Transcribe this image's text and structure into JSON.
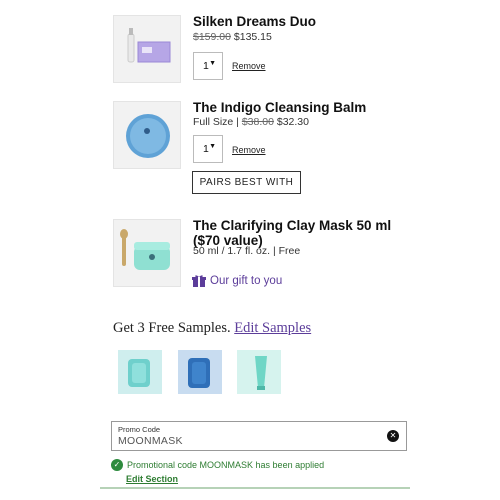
{
  "cart": {
    "items": [
      {
        "name": "Silken Dreams Duo",
        "original_price": "$159.00",
        "price": "$135.15",
        "qty": "1",
        "remove_label": "Remove",
        "thumb_icon": "silken-dreams-duo-product"
      },
      {
        "name": "The Indigo Cleansing Balm",
        "size_prefix": "Full Size | ",
        "original_price": "$38.00",
        "price": "$32.30",
        "qty": "1",
        "remove_label": "Remove",
        "pairs_label": "PAIRS BEST WITH",
        "thumb_icon": "indigo-balm-jar"
      },
      {
        "name_line1": "The Clarifying Clay Mask 50 ml",
        "name_line2": "($70 value)",
        "detail": "50 ml / 1.7 fl. oz. | Free",
        "gift_label": "Our gift to you",
        "thumb_icon": "clay-mask-jar"
      }
    ]
  },
  "samples": {
    "title": "Get 3 Free Samples. ",
    "edit_label": "Edit Samples",
    "items": [
      "aqua-sample",
      "blue-sample",
      "teal-tube-sample"
    ]
  },
  "promo": {
    "label": "Promo Code",
    "value": "MOONMASK",
    "applied_message": "Promotional code MOONMASK has been applied",
    "edit_section_label": "Edit Section"
  },
  "colors": {
    "accent_purple": "#5c3d9a",
    "success_green": "#2e7d32"
  }
}
